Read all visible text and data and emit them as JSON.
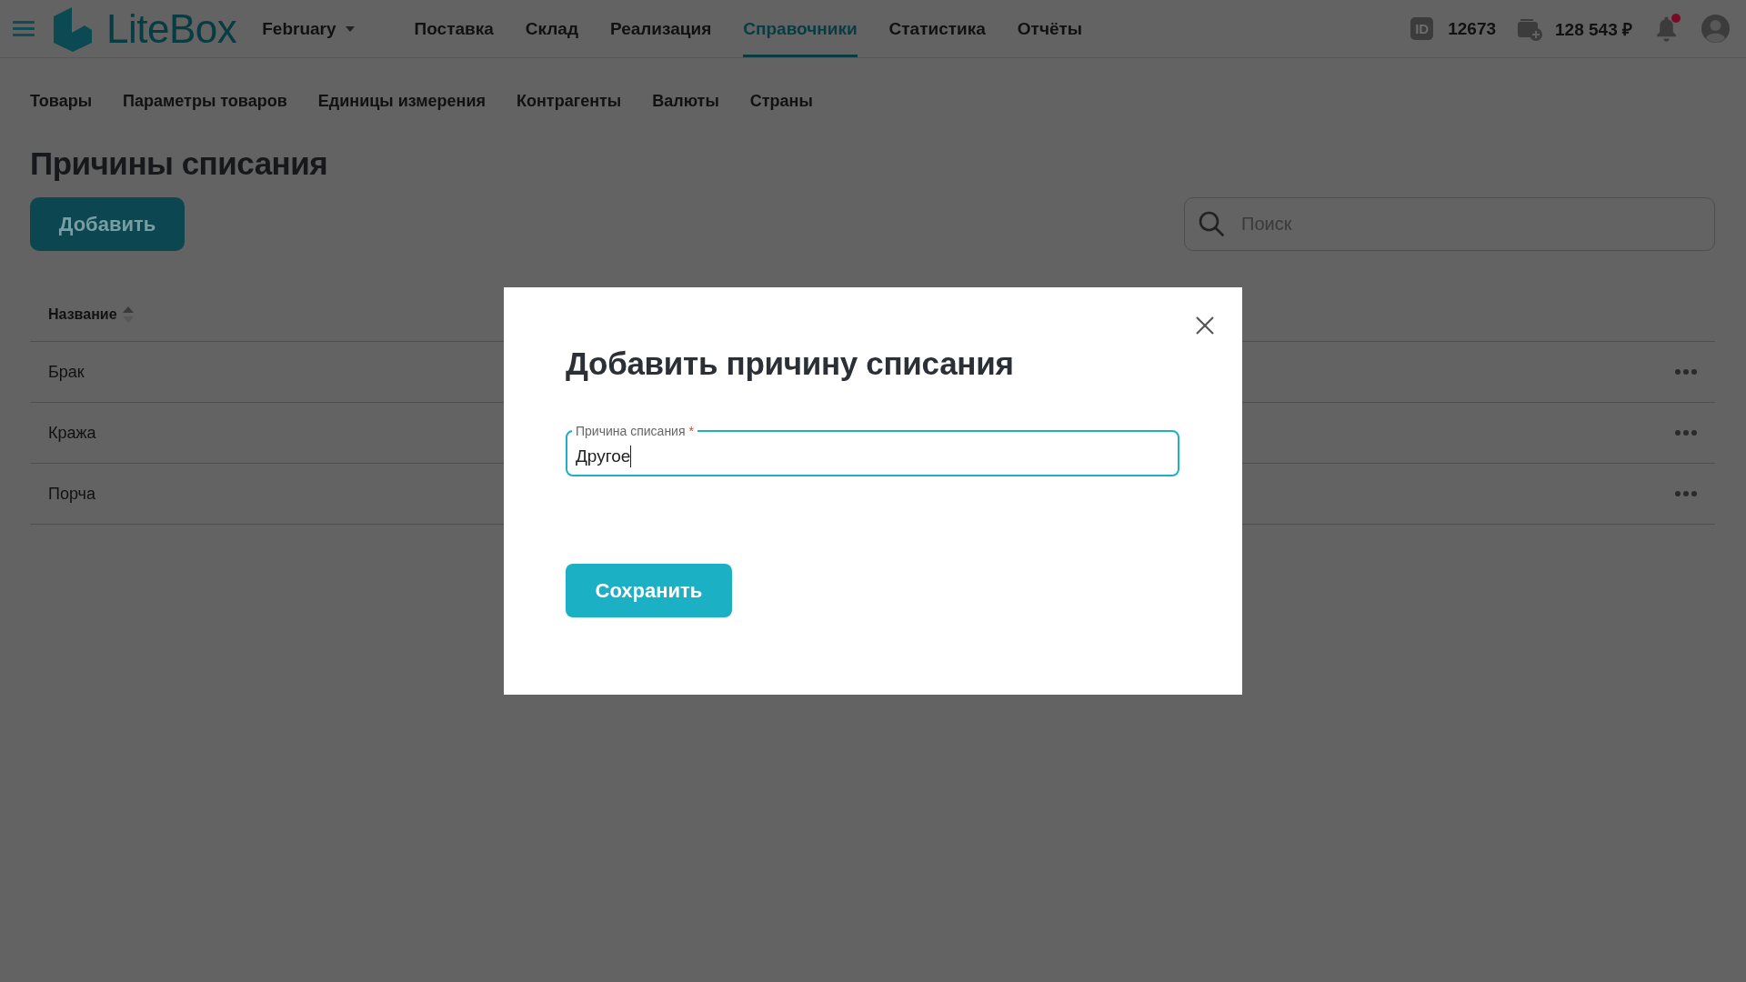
{
  "topbar": {
    "brand": "LiteBox",
    "period": {
      "label": "February"
    },
    "nav": [
      {
        "label": "Поставка",
        "selected": false
      },
      {
        "label": "Склад",
        "selected": false
      },
      {
        "label": "Реализация",
        "selected": false
      },
      {
        "label": "Справочники",
        "selected": true
      },
      {
        "label": "Статистика",
        "selected": false
      },
      {
        "label": "Отчёты",
        "selected": false
      }
    ],
    "account_id": {
      "badge": "ID",
      "value": "12673"
    },
    "balance": "128 543 ₽",
    "notifications": {
      "unread": true
    }
  },
  "subnav": [
    {
      "label": "Товары",
      "selected": false
    },
    {
      "label": "Параметры товаров",
      "selected": false
    },
    {
      "label": "Единицы измерения",
      "selected": false
    },
    {
      "label": "Контрагенты",
      "selected": false
    },
    {
      "label": "Валюты",
      "selected": false
    },
    {
      "label": "Страны",
      "selected": false
    }
  ],
  "page": {
    "title": "Причины списания",
    "add_button": "Добавить",
    "search": {
      "placeholder": "Поиск"
    }
  },
  "table": {
    "columns": [
      {
        "label": "Название",
        "sort_ascending": true
      }
    ],
    "rows": [
      {
        "name": "Брак"
      },
      {
        "name": "Кража"
      },
      {
        "name": "Порча"
      }
    ]
  },
  "modal": {
    "title": "Добавить причину списания",
    "field": {
      "label": "Причина списания",
      "required_mark": "*",
      "value": "Другое",
      "focused": true
    },
    "save_button": "Сохранить"
  }
}
